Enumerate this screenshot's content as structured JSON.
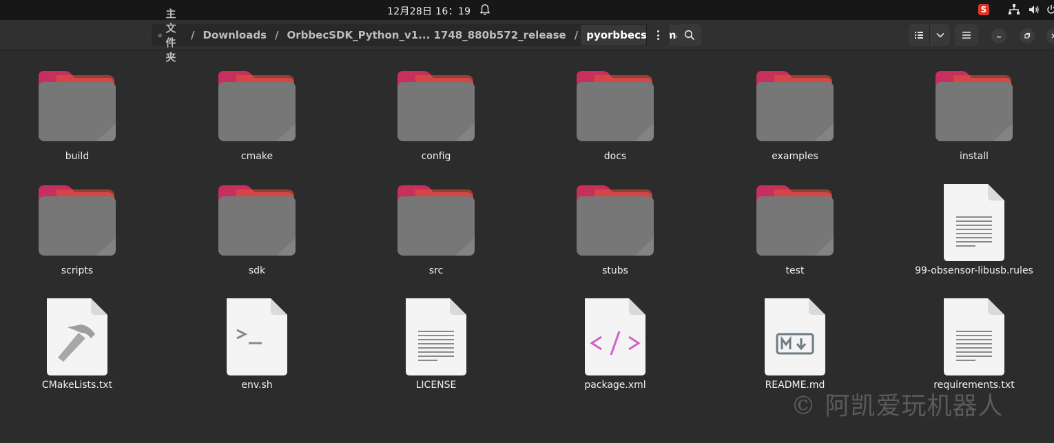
{
  "topbar": {
    "clock": "12月28日  16：19",
    "ime_badge": "S",
    "icons": [
      "bell-icon",
      "network-icon",
      "volume-icon",
      "power-icon"
    ]
  },
  "header": {
    "breadcrumbs": [
      {
        "label": "主文件夹",
        "icon": "home-icon"
      },
      {
        "label": "Downloads"
      },
      {
        "label": "OrbbecSDK_Python_v1... 1748_880b572_release"
      },
      {
        "label": "pyorbbecsdk-main",
        "current": true
      }
    ]
  },
  "files": [
    {
      "name": "build",
      "type": "folder"
    },
    {
      "name": "cmake",
      "type": "folder"
    },
    {
      "name": "config",
      "type": "folder"
    },
    {
      "name": "docs",
      "type": "folder"
    },
    {
      "name": "examples",
      "type": "folder"
    },
    {
      "name": "install",
      "type": "folder"
    },
    {
      "name": "scripts",
      "type": "folder"
    },
    {
      "name": "sdk",
      "type": "folder"
    },
    {
      "name": "src",
      "type": "folder"
    },
    {
      "name": "stubs",
      "type": "folder"
    },
    {
      "name": "test",
      "type": "folder"
    },
    {
      "name": "99-obsensor-libusb.rules",
      "type": "text"
    },
    {
      "name": "CMakeLists.txt",
      "type": "cmake"
    },
    {
      "name": "env.sh",
      "type": "script"
    },
    {
      "name": "LICENSE",
      "type": "text"
    },
    {
      "name": "package.xml",
      "type": "xml"
    },
    {
      "name": "README.md",
      "type": "markdown"
    },
    {
      "name": "requirements.txt",
      "type": "text"
    }
  ],
  "watermark": "© 阿凯爱玩机器人",
  "colors": {
    "background": "#2c2c2c",
    "folder_tab": "#c7305c",
    "folder_body": "#777777",
    "xml_accent": "#d35fc9"
  }
}
